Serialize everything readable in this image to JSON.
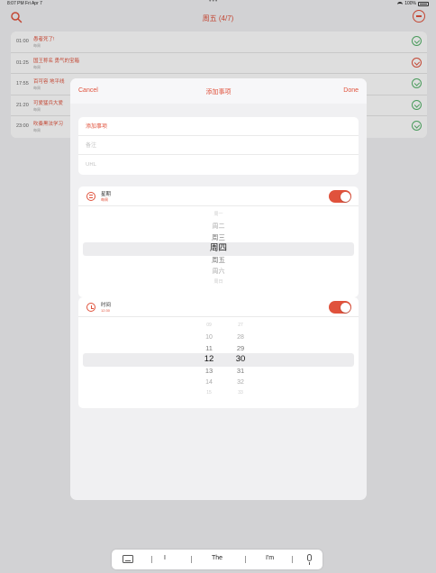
{
  "status_bar": {
    "time_date": "8:07 PM  Fri Apr 7",
    "center_dots": "•••",
    "battery": "100%"
  },
  "app": {
    "title": "周五 (4/7)",
    "icons": {
      "search": "search-icon",
      "more": "more-icon"
    },
    "events": [
      {
        "time": "01:00",
        "title": "愚者死了!",
        "sub": "每周",
        "done": false
      },
      {
        "time": "01:25",
        "title": "国王称名 勇气的宝箱",
        "sub": "每周",
        "done": true
      },
      {
        "time": "17:55",
        "title": "百可容 地平线",
        "sub": "每周",
        "done": false
      },
      {
        "time": "21:20",
        "title": "可爱猛兵大爱",
        "sub": "每周",
        "done": false
      },
      {
        "time": "23:00",
        "title": "吹奏黑法学习",
        "sub": "每周",
        "done": false
      }
    ]
  },
  "sheet": {
    "cancel_label": "Cancel",
    "title": "添加事项",
    "done_label": "Done",
    "fields": {
      "title_placeholder": "添加事项",
      "notes_placeholder": "备注",
      "url_placeholder": "URL"
    },
    "date_option": {
      "label": "星期",
      "value": "每周",
      "enabled": true
    },
    "day_picker": [
      "周一",
      "周二",
      "周三",
      "周四",
      "周五",
      "周六",
      "周日"
    ],
    "day_selected_index": 3,
    "time_option": {
      "label": "时间",
      "value": "12:30",
      "enabled": true
    },
    "hour_picker": [
      "09",
      "10",
      "11",
      "12",
      "13",
      "14",
      "15"
    ],
    "minute_picker": [
      "27",
      "28",
      "29",
      "30",
      "31",
      "32",
      "33"
    ],
    "time_selected_index": 3
  },
  "keyboard_bar": {
    "suggestion_1": "I",
    "suggestion_2": "The",
    "suggestion_3": "I'm"
  },
  "colors": {
    "accent": "#e0523c",
    "done": "#55b36a"
  }
}
